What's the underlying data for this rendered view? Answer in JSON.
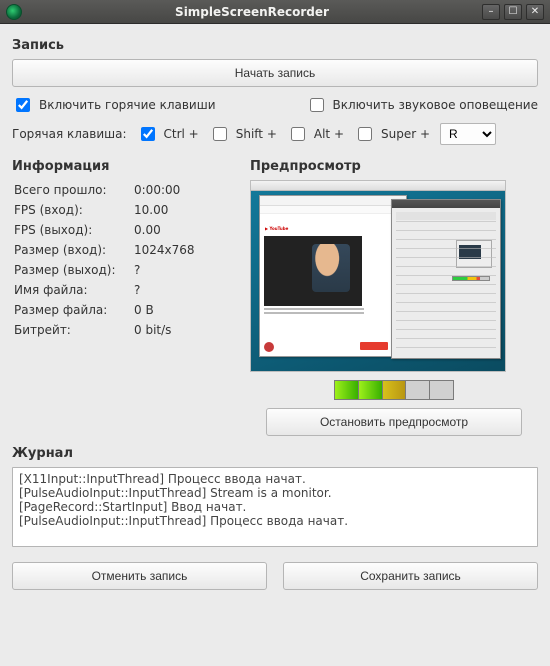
{
  "window": {
    "title": "SimpleScreenRecorder"
  },
  "record": {
    "heading": "Запись",
    "start_label": "Начать запись",
    "hotkeys_enable_label": "Включить горячие клавиши",
    "hotkeys_enable_checked": true,
    "sound_notify_label": "Включить звуковое оповещение",
    "sound_notify_checked": false,
    "hotkey_label": "Горячая клавиша:",
    "mods": {
      "ctrl_label": "Ctrl +",
      "ctrl_checked": true,
      "shift_label": "Shift +",
      "shift_checked": false,
      "alt_label": "Alt +",
      "alt_checked": false,
      "super_label": "Super +",
      "super_checked": false
    },
    "key_selected": "R"
  },
  "info": {
    "heading": "Информация",
    "rows": [
      {
        "k": "Всего прошло:",
        "v": "0:00:00"
      },
      {
        "k": "FPS (вход):",
        "v": "10.00"
      },
      {
        "k": "FPS (выход):",
        "v": "0.00"
      },
      {
        "k": "Размер (вход):",
        "v": "1024x768"
      },
      {
        "k": "Размер (выход):",
        "v": "?"
      },
      {
        "k": "Имя файла:",
        "v": "?"
      },
      {
        "k": "Размер файла:",
        "v": "0 B"
      },
      {
        "k": "Битрейт:",
        "v": "0 bit/s"
      }
    ]
  },
  "preview": {
    "heading": "Предпросмотр",
    "stop_label": "Остановить предпросмотр"
  },
  "log": {
    "heading": "Журнал",
    "text": "[X11Input::InputThread] Процесс ввода начат.\n[PulseAudioInput::InputThread] Stream is a monitor.\n[PageRecord::StartInput] Ввод начат.\n[PulseAudioInput::InputThread] Процесс ввода начат."
  },
  "footer": {
    "cancel_label": "Отменить запись",
    "save_label": "Сохранить запись"
  }
}
